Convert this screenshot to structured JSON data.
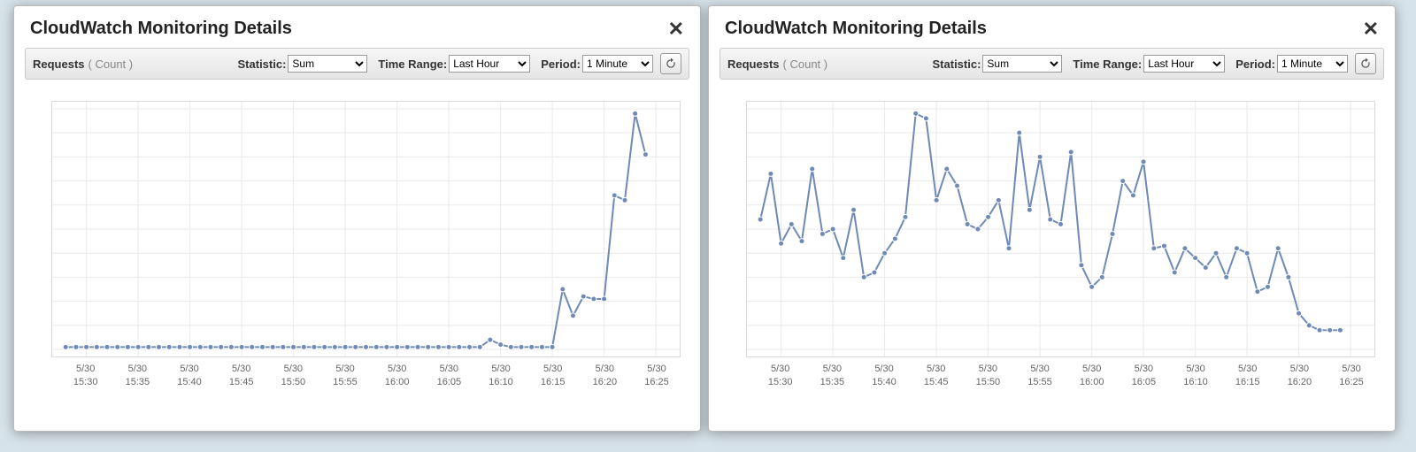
{
  "panels": [
    {
      "title": "CloudWatch Monitoring Details",
      "toolbar": {
        "metric_label": "Requests",
        "metric_unit": "( Count )",
        "statistic_label": "Statistic:",
        "statistic_value": "Sum",
        "time_range_label": "Time Range:",
        "time_range_value": "Last Hour",
        "period_label": "Period:",
        "period_value": "1 Minute"
      }
    },
    {
      "title": "CloudWatch Monitoring Details",
      "toolbar": {
        "metric_label": "Requests",
        "metric_unit": "( Count )",
        "statistic_label": "Statistic:",
        "statistic_value": "Sum",
        "time_range_label": "Time Range:",
        "time_range_value": "Last Hour",
        "period_label": "Period:",
        "period_value": "1 Minute"
      }
    }
  ],
  "x_ticks": [
    {
      "date": "5/30",
      "time": "15:30"
    },
    {
      "date": "5/30",
      "time": "15:35"
    },
    {
      "date": "5/30",
      "time": "15:40"
    },
    {
      "date": "5/30",
      "time": "15:45"
    },
    {
      "date": "5/30",
      "time": "15:50"
    },
    {
      "date": "5/30",
      "time": "15:55"
    },
    {
      "date": "5/30",
      "time": "16:00"
    },
    {
      "date": "5/30",
      "time": "16:05"
    },
    {
      "date": "5/30",
      "time": "16:10"
    },
    {
      "date": "5/30",
      "time": "16:15"
    },
    {
      "date": "5/30",
      "time": "16:20"
    },
    {
      "date": "5/30",
      "time": "16:25"
    }
  ],
  "chart_data": [
    {
      "type": "line",
      "title": "Requests (Count)",
      "xlabel": "",
      "ylabel": "",
      "ylim": [
        0,
        100
      ],
      "x_minutes_start": -2,
      "x_minutes_end": 56,
      "categories_min": [
        "15:28",
        "15:29",
        "15:30",
        "15:31",
        "15:32",
        "15:33",
        "15:34",
        "15:35",
        "15:36",
        "15:37",
        "15:38",
        "15:39",
        "15:40",
        "15:41",
        "15:42",
        "15:43",
        "15:44",
        "15:45",
        "15:46",
        "15:47",
        "15:48",
        "15:49",
        "15:50",
        "15:51",
        "15:52",
        "15:53",
        "15:54",
        "15:55",
        "15:56",
        "15:57",
        "15:58",
        "15:59",
        "16:00",
        "16:01",
        "16:02",
        "16:03",
        "16:04",
        "16:05",
        "16:06",
        "16:07",
        "16:08",
        "16:09",
        "16:10",
        "16:11",
        "16:12",
        "16:13",
        "16:14",
        "16:15",
        "16:16",
        "16:17",
        "16:18",
        "16:19",
        "16:20",
        "16:21",
        "16:22",
        "16:23",
        "16:24"
      ],
      "values": [
        1,
        1,
        1,
        1,
        1,
        1,
        1,
        1,
        1,
        1,
        1,
        1,
        1,
        1,
        1,
        1,
        1,
        1,
        1,
        1,
        1,
        1,
        1,
        1,
        1,
        1,
        1,
        1,
        1,
        1,
        1,
        1,
        1,
        1,
        1,
        1,
        1,
        1,
        1,
        1,
        1,
        4,
        2,
        1,
        1,
        1,
        1,
        1,
        25,
        14,
        22,
        21,
        21,
        64,
        62,
        98,
        81
      ]
    },
    {
      "type": "line",
      "title": "Requests (Count)",
      "xlabel": "",
      "ylabel": "",
      "ylim": [
        0,
        100
      ],
      "x_minutes_start": -2,
      "x_minutes_end": 56,
      "categories_min": [
        "15:28",
        "15:29",
        "15:30",
        "15:31",
        "15:32",
        "15:33",
        "15:34",
        "15:35",
        "15:36",
        "15:37",
        "15:38",
        "15:39",
        "15:40",
        "15:41",
        "15:42",
        "15:43",
        "15:44",
        "15:45",
        "15:46",
        "15:47",
        "15:48",
        "15:49",
        "15:50",
        "15:51",
        "15:52",
        "15:53",
        "15:54",
        "15:55",
        "15:56",
        "15:57",
        "15:58",
        "15:59",
        "16:00",
        "16:01",
        "16:02",
        "16:03",
        "16:04",
        "16:05",
        "16:06",
        "16:07",
        "16:08",
        "16:09",
        "16:10",
        "16:11",
        "16:12",
        "16:13",
        "16:14",
        "16:15",
        "16:16",
        "16:17",
        "16:18",
        "16:19",
        "16:20",
        "16:21",
        "16:22",
        "16:23",
        "16:24"
      ],
      "values": [
        54,
        73,
        44,
        52,
        45,
        75,
        48,
        50,
        38,
        58,
        30,
        32,
        40,
        46,
        55,
        98,
        96,
        62,
        75,
        68,
        52,
        50,
        55,
        62,
        42,
        90,
        58,
        80,
        54,
        52,
        82,
        35,
        26,
        30,
        48,
        70,
        64,
        78,
        42,
        43,
        32,
        42,
        38,
        34,
        40,
        30,
        42,
        40,
        24,
        26,
        42,
        30,
        15,
        10,
        8,
        8,
        8
      ]
    }
  ]
}
